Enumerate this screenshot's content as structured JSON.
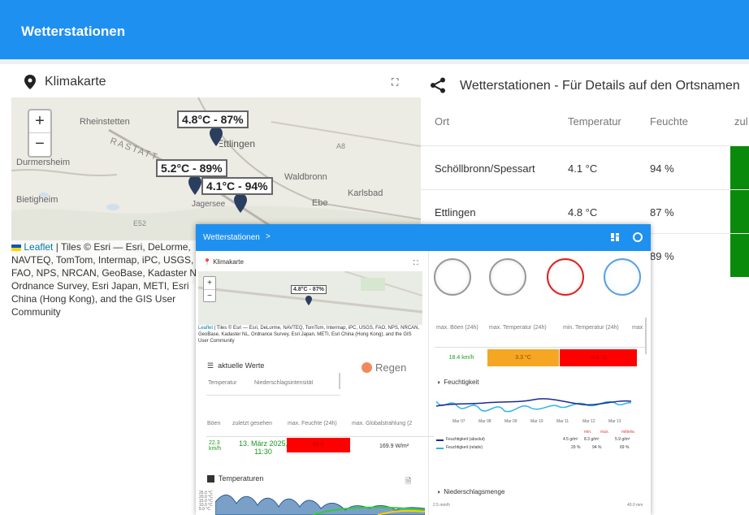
{
  "app": {
    "title": "Wetterstationen"
  },
  "map_card": {
    "title": "Klimakarte",
    "zoom_in": "+",
    "zoom_out": "−",
    "place_labels": [
      "Rheinstetten",
      "RASTATT",
      "Durmersheim",
      "Bietigheim",
      "Waldbronn",
      "Karlsbad",
      "Ettlingen",
      "Jagersee",
      "Ebe",
      "A8",
      "E52"
    ],
    "tooltips": [
      "4.8°C - 87%",
      "5.2°C - 89%",
      "4.1°C - 94%"
    ],
    "attribution_link": "Leaflet",
    "attribution_text": " | Tiles © Esri — Esri, DeLorme, NAVTEQ, TomTom, Intermap, iPC, USGS, FAO, NPS, NRCAN, GeoBase, Kadaster NL, Ordnance Survey, Esri Japan, METI, Esri China (Hong Kong), and the GIS User Community"
  },
  "table_card": {
    "title": "Wetterstationen - Für Details auf den Ortsnamen",
    "columns": [
      "Ort",
      "Temperatur",
      "Feuchte",
      "zul"
    ],
    "rows": [
      {
        "ort": "Schöllbronn/Spessart",
        "temp": "4.1 °C",
        "feuchte": "94 %"
      },
      {
        "ort": "Ettlingen",
        "temp": "4.8 °C",
        "feuchte": "87 %"
      },
      {
        "ort": "",
        "temp": "",
        "feuchte": "89 %"
      }
    ],
    "accent_green": "#0a8a0a"
  },
  "overlay": {
    "bar_title": "Wetterstationen",
    "bar_chevron": ">",
    "map_title": "Klimakarte",
    "map_tip": "4.8°C - 87%",
    "map_attr_link": "Leaflet",
    "map_attr_text": " | Tiles © Esri — Esri, DeLorme, NAVTEQ, TomTom, Intermap, iPC, USGS, FAO, NPS, NRCAN, GeoBase, Kadaster NL, Ordnance Survey, Esri Japan, METI, Esri China (Hong Kong), and the GIS User Community",
    "current_title": "aktuelle Werte",
    "rain_label": "Regen",
    "current_cols": [
      "Temperatur",
      "Niederschlagsintensität"
    ],
    "bottom_cols": [
      "Böen",
      "zuletzt gesehen",
      "max. Feuchte (24h)",
      "max. Globalstrahlung (2"
    ],
    "bottom_vals": {
      "boeen": "22.3 km/h",
      "seen": "13. März 2025, 11:30",
      "feuchte": "90 %",
      "strahlung": "169.9 W/m²"
    },
    "temps_title": "Temperaturen",
    "temps_ticks": [
      "25.0 °C",
      "20.0 °C",
      "15.0 °C",
      "10.0 °C",
      "5.0 °C"
    ],
    "gauge_caps": [
      "max. Böen (24h)",
      "max. Temperatur (24h)",
      "min. Temperatur (24h)",
      "max"
    ],
    "gauge_vals": [
      "18.4 km/h",
      "3.3 °C",
      "-0.6 °C"
    ],
    "gauge_colors": [
      "#ffffff",
      "#f5a623",
      "#e02020"
    ],
    "humidity_title": "Feuchtigkeit",
    "humidity_x": [
      "Mar 07",
      "Mar 08",
      "Mar 09",
      "Mar 10",
      "Mar 11",
      "Mar 12",
      "Mar 13"
    ],
    "humidity_stats_head": [
      "min.",
      "max.",
      "mittelw."
    ],
    "humidity_series": [
      {
        "name": "Feuchtigkeit (absolut)",
        "min": "4.5 g/m³",
        "max": "8.3 g/m³",
        "avg": "5.9 g/m³",
        "color": "#1c2a8c"
      },
      {
        "name": "Feuchtigkeit (relativ)",
        "min": "29 %",
        "max": "94 %",
        "avg": "69 %",
        "color": "#2fb3e8"
      }
    ],
    "rain_title": "Niederschlagsmenge",
    "rain_left": "2.5 mm/h",
    "rain_right": "40.0 mm"
  }
}
